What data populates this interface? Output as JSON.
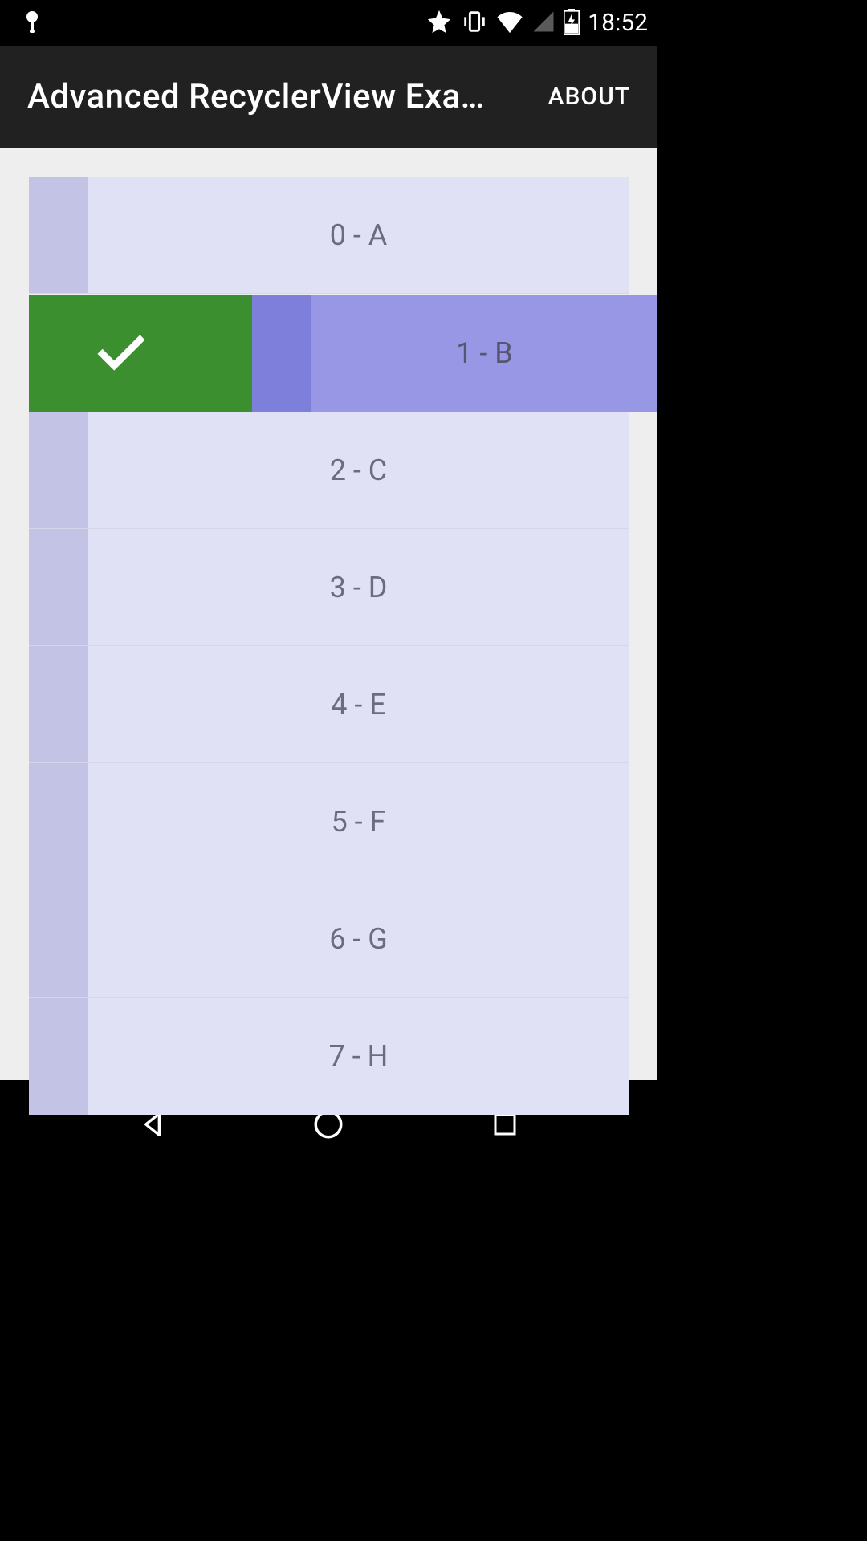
{
  "status": {
    "time": "18:52"
  },
  "header": {
    "title": "Advanced RecyclerView Exa…",
    "about_label": "ABOUT"
  },
  "list": {
    "items": [
      {
        "label": "0 - A"
      },
      {
        "label": "1 - B"
      },
      {
        "label": "2 - C"
      },
      {
        "label": "3 - D"
      },
      {
        "label": "4 - E"
      },
      {
        "label": "5 - F"
      },
      {
        "label": "6 - G"
      },
      {
        "label": "7 - H"
      }
    ]
  }
}
